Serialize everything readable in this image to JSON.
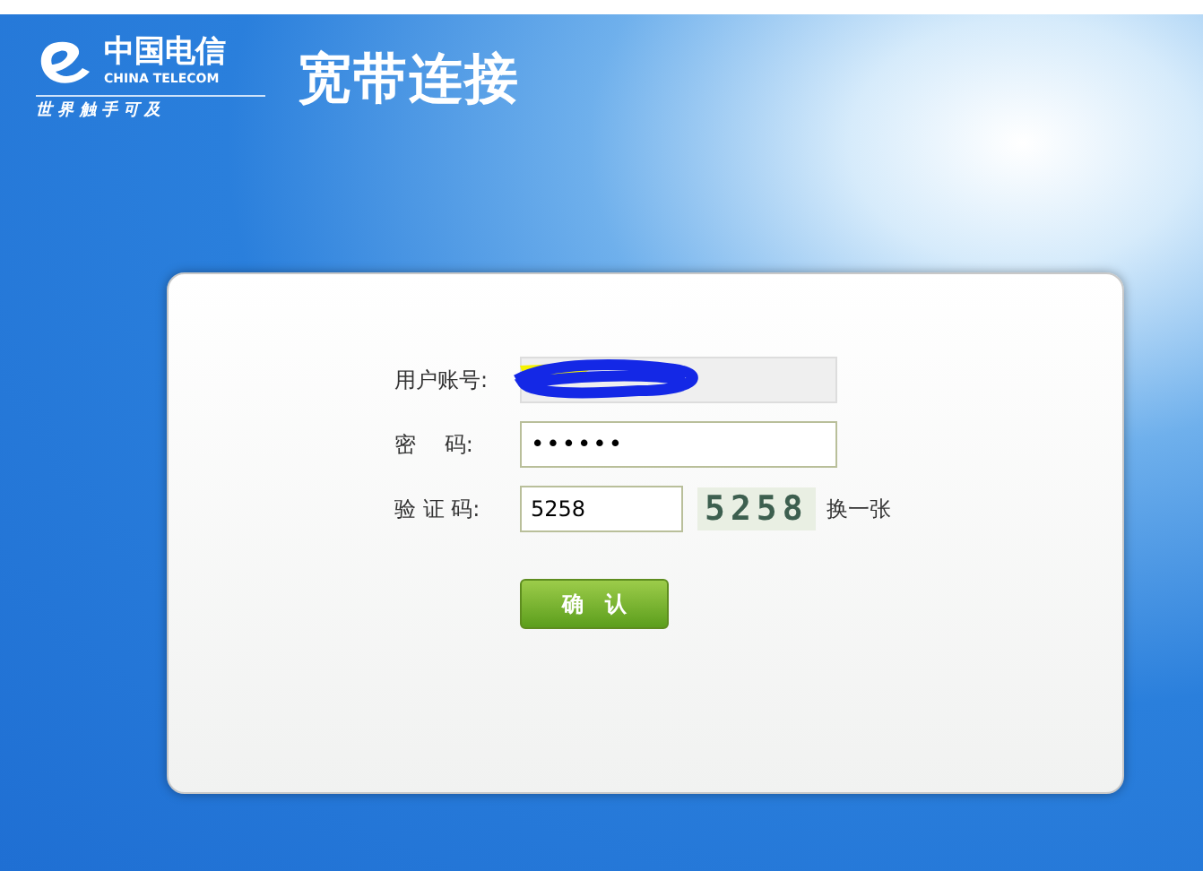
{
  "header": {
    "brand_cn": "中国电信",
    "brand_en": "CHINA TELECOM",
    "slogan": "世 界 触 手 可 及",
    "title": "宽带连接"
  },
  "form": {
    "fields": [
      {
        "label": "用户账号:",
        "kind": "redacted",
        "disabled": true
      },
      {
        "label": "密　 码:",
        "kind": "password",
        "value": "••••••",
        "disabled": false
      },
      {
        "label": "验 证 码:",
        "kind": "captcha",
        "value": "5258",
        "disabled": false,
        "captcha_image": "5258",
        "refresh_link": "换一张"
      }
    ],
    "submit": "确　认"
  }
}
